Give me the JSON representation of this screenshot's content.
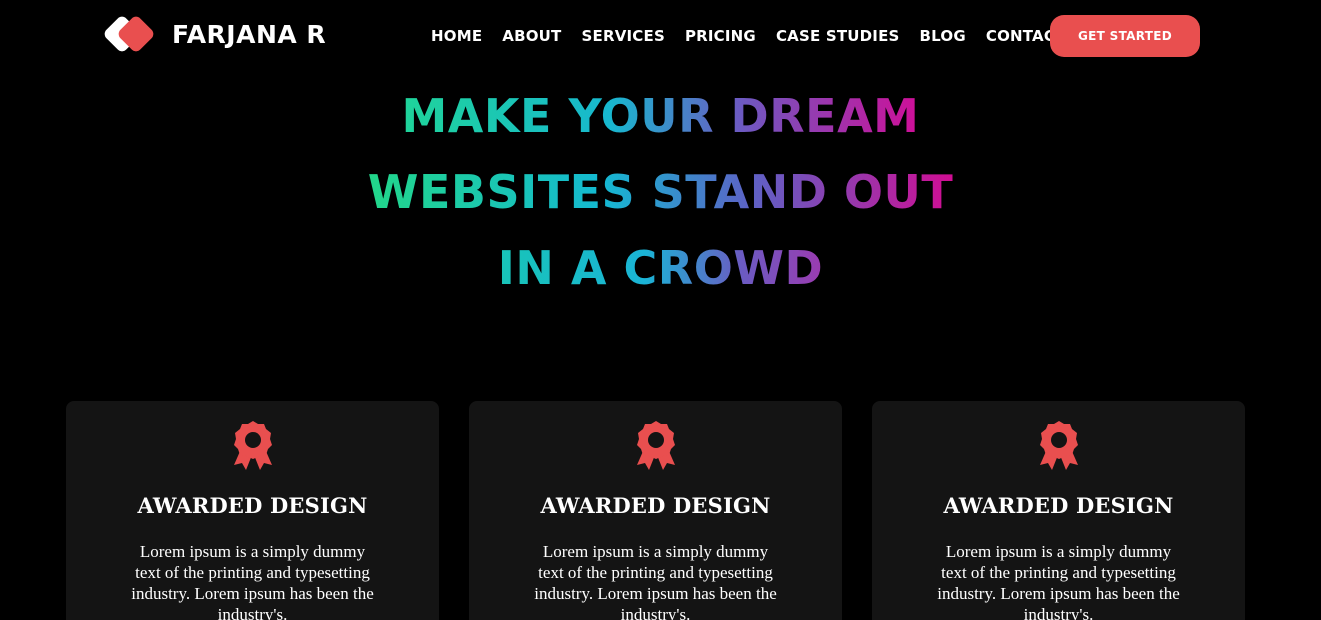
{
  "brand": {
    "name": "FARJANA R",
    "accent_color": "#e94f4f"
  },
  "nav": {
    "items": [
      "HOME",
      "ABOUT",
      "SERVICES",
      "PRICING",
      "CASE STUDIES",
      "BLOG",
      "CONTACT"
    ],
    "cta_label": "GET STARTED"
  },
  "hero": {
    "lines": [
      "MAKE YOUR DREAM",
      "WEBSITES STAND OUT",
      "IN A CROWD"
    ]
  },
  "cards": [
    {
      "icon": "award-ribbon-icon",
      "title": "AWARDED DESIGN",
      "text": "Lorem ipsum is a simply dummy text of the printing and typesetting industry. Lorem ipsum has been the industry's."
    },
    {
      "icon": "award-ribbon-icon",
      "title": "AWARDED DESIGN",
      "text": "Lorem ipsum is a simply dummy text of the printing and typesetting industry. Lorem ipsum has been the industry's."
    },
    {
      "icon": "award-ribbon-icon",
      "title": "AWARDED DESIGN",
      "text": "Lorem ipsum is a simply dummy text of the printing and typesetting industry. Lorem ipsum has been the industry's."
    }
  ]
}
